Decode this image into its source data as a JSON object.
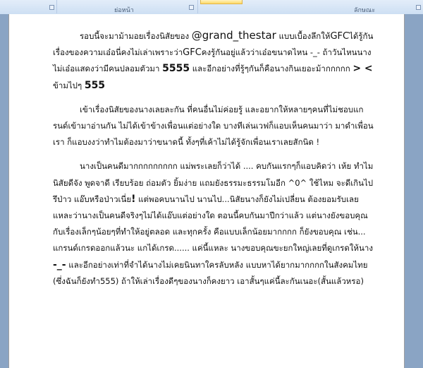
{
  "ribbon": {
    "group_paragraph": "ย่อหน้า",
    "group_styles": "ลักษณะ"
  },
  "document": {
    "p1": {
      "text1": "รอบนี้จะมาม้ามอยเรื่องนิสัยของ ",
      "mention": "@grand_thestar",
      "text2": " แบบเบื้องลึกให้",
      "gfc1": "GFC",
      "text3": "ได้รู้กัน เรื่องของความเอ๋อนี่คงไม่เล่าเพราะว่า",
      "gfc2": "GFC",
      "text4": "คงรู้กันอยู่แล้วว่าเอ๋อขนาดไหน -_- ถ้าวันไหนนางไม่เอ๋อแสดงว่ามีคนปลอมตัวมา ",
      "laugh": "5555",
      "text5": " และอีกอย่างที่รู้ๆกันก็คือนางกินเยอะม้ากกกกก ",
      "text6": "> <",
      "text7": " ข้ามไปๆ ",
      "laugh2": "555"
    },
    "p2": "เข้าเรื่องนิสัยของนางเลยละกัน ที่คนอื่นไม่ค่อยรู้ และอยากให้หลายๆคนที่ไม่ชอบแกรนด์เข้ามาอ่านกัน ไม่ได้เข้าข้างเพื่อนแต่อย่างใด บางทีเล่นเวฟก็แอบเห็นคนมาว่า มาดำเพื่อนเรา ก็แอบงงว่าทำไมต้องมาว่าขนาดนี้ ทั้งๆที่เค้าไม่ได้รู้จักเพื่อนเราเลยสักนิด !",
    "p3": {
      "text1": "นางเป็นคนดีมากกกกกกกกก แม่พระเลยก็ว่าได้ .... คบกันแรกๆก็แอบคิดว่า เห้ย ทำไมนิสัยดีจัง พูดจาดี เรียบร้อย ถ่อมตัว ยิ้มง่าย แถมยังธรรมะธรรมโมอีก ^0^ ใช้ไหม จะดีเกินไปรึป่าว แอ๊บหรือป่าวเนี่ย",
      "bang": "!",
      "text2": " แต่พอคบนานไป นานไป...นิสัยนางก็ยังไม่เปลี่ยน ต้องยอมรับเลยแหละว่านางเป็นคนดีจริงๆไม่ได้แอ๊บแต่อย่างใด ตอนนี้คบกันมาปีกว่าแล้ว แต่นางยังขอบคุณกับเรื่องเล็กๆน้อยๆที่ทำให้อยู่ตลอด และทุกครั้ง คือแบบเล็กน้อยมากกกก ก็ยังขอบคุณ เช่น... แกรนด์เกรดออกแล้วนะ แกได้เกรด...... แค่นี้แหละ นางขอบคุณขะยกใหญ่เลยที่ดูเกรดให้นาง ",
      "face": "-_-",
      "text3": " และอีกอย่างเท่าที่จำได้นางไม่เคยนินทาใครลับหลัง แบบหาได้ยากมากกกกในสังคมไทย (ซึ่งฉันก็ยังทำ555) ถ้าให้เล่าเรื่องดีๆของนางก็คงยาว เอาสั้นๆแค่นี้ละกันเนอะ(สั้นแล้วหรอ)"
    }
  }
}
